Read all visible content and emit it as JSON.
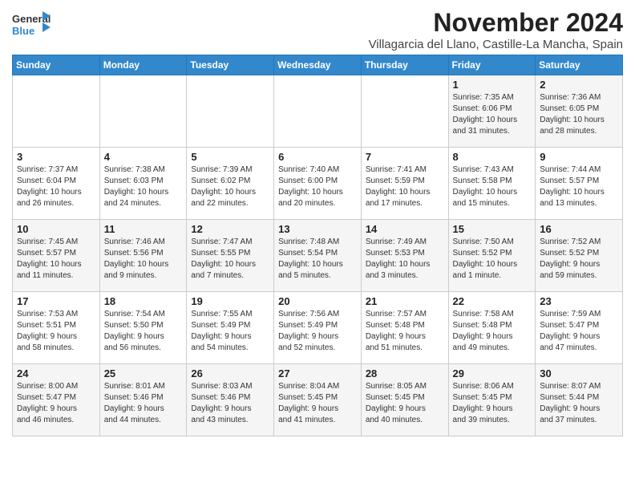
{
  "logo": {
    "general": "General",
    "blue": "Blue"
  },
  "title": "November 2024",
  "subtitle": "Villagarcia del Llano, Castille-La Mancha, Spain",
  "days_of_week": [
    "Sunday",
    "Monday",
    "Tuesday",
    "Wednesday",
    "Thursday",
    "Friday",
    "Saturday"
  ],
  "weeks": [
    [
      {
        "day": "",
        "info": ""
      },
      {
        "day": "",
        "info": ""
      },
      {
        "day": "",
        "info": ""
      },
      {
        "day": "",
        "info": ""
      },
      {
        "day": "",
        "info": ""
      },
      {
        "day": "1",
        "info": "Sunrise: 7:35 AM\nSunset: 6:06 PM\nDaylight: 10 hours\nand 31 minutes."
      },
      {
        "day": "2",
        "info": "Sunrise: 7:36 AM\nSunset: 6:05 PM\nDaylight: 10 hours\nand 28 minutes."
      }
    ],
    [
      {
        "day": "3",
        "info": "Sunrise: 7:37 AM\nSunset: 6:04 PM\nDaylight: 10 hours\nand 26 minutes."
      },
      {
        "day": "4",
        "info": "Sunrise: 7:38 AM\nSunset: 6:03 PM\nDaylight: 10 hours\nand 24 minutes."
      },
      {
        "day": "5",
        "info": "Sunrise: 7:39 AM\nSunset: 6:02 PM\nDaylight: 10 hours\nand 22 minutes."
      },
      {
        "day": "6",
        "info": "Sunrise: 7:40 AM\nSunset: 6:00 PM\nDaylight: 10 hours\nand 20 minutes."
      },
      {
        "day": "7",
        "info": "Sunrise: 7:41 AM\nSunset: 5:59 PM\nDaylight: 10 hours\nand 17 minutes."
      },
      {
        "day": "8",
        "info": "Sunrise: 7:43 AM\nSunset: 5:58 PM\nDaylight: 10 hours\nand 15 minutes."
      },
      {
        "day": "9",
        "info": "Sunrise: 7:44 AM\nSunset: 5:57 PM\nDaylight: 10 hours\nand 13 minutes."
      }
    ],
    [
      {
        "day": "10",
        "info": "Sunrise: 7:45 AM\nSunset: 5:57 PM\nDaylight: 10 hours\nand 11 minutes."
      },
      {
        "day": "11",
        "info": "Sunrise: 7:46 AM\nSunset: 5:56 PM\nDaylight: 10 hours\nand 9 minutes."
      },
      {
        "day": "12",
        "info": "Sunrise: 7:47 AM\nSunset: 5:55 PM\nDaylight: 10 hours\nand 7 minutes."
      },
      {
        "day": "13",
        "info": "Sunrise: 7:48 AM\nSunset: 5:54 PM\nDaylight: 10 hours\nand 5 minutes."
      },
      {
        "day": "14",
        "info": "Sunrise: 7:49 AM\nSunset: 5:53 PM\nDaylight: 10 hours\nand 3 minutes."
      },
      {
        "day": "15",
        "info": "Sunrise: 7:50 AM\nSunset: 5:52 PM\nDaylight: 10 hours\nand 1 minute."
      },
      {
        "day": "16",
        "info": "Sunrise: 7:52 AM\nSunset: 5:52 PM\nDaylight: 9 hours\nand 59 minutes."
      }
    ],
    [
      {
        "day": "17",
        "info": "Sunrise: 7:53 AM\nSunset: 5:51 PM\nDaylight: 9 hours\nand 58 minutes."
      },
      {
        "day": "18",
        "info": "Sunrise: 7:54 AM\nSunset: 5:50 PM\nDaylight: 9 hours\nand 56 minutes."
      },
      {
        "day": "19",
        "info": "Sunrise: 7:55 AM\nSunset: 5:49 PM\nDaylight: 9 hours\nand 54 minutes."
      },
      {
        "day": "20",
        "info": "Sunrise: 7:56 AM\nSunset: 5:49 PM\nDaylight: 9 hours\nand 52 minutes."
      },
      {
        "day": "21",
        "info": "Sunrise: 7:57 AM\nSunset: 5:48 PM\nDaylight: 9 hours\nand 51 minutes."
      },
      {
        "day": "22",
        "info": "Sunrise: 7:58 AM\nSunset: 5:48 PM\nDaylight: 9 hours\nand 49 minutes."
      },
      {
        "day": "23",
        "info": "Sunrise: 7:59 AM\nSunset: 5:47 PM\nDaylight: 9 hours\nand 47 minutes."
      }
    ],
    [
      {
        "day": "24",
        "info": "Sunrise: 8:00 AM\nSunset: 5:47 PM\nDaylight: 9 hours\nand 46 minutes."
      },
      {
        "day": "25",
        "info": "Sunrise: 8:01 AM\nSunset: 5:46 PM\nDaylight: 9 hours\nand 44 minutes."
      },
      {
        "day": "26",
        "info": "Sunrise: 8:03 AM\nSunset: 5:46 PM\nDaylight: 9 hours\nand 43 minutes."
      },
      {
        "day": "27",
        "info": "Sunrise: 8:04 AM\nSunset: 5:45 PM\nDaylight: 9 hours\nand 41 minutes."
      },
      {
        "day": "28",
        "info": "Sunrise: 8:05 AM\nSunset: 5:45 PM\nDaylight: 9 hours\nand 40 minutes."
      },
      {
        "day": "29",
        "info": "Sunrise: 8:06 AM\nSunset: 5:45 PM\nDaylight: 9 hours\nand 39 minutes."
      },
      {
        "day": "30",
        "info": "Sunrise: 8:07 AM\nSunset: 5:44 PM\nDaylight: 9 hours\nand 37 minutes."
      }
    ]
  ]
}
